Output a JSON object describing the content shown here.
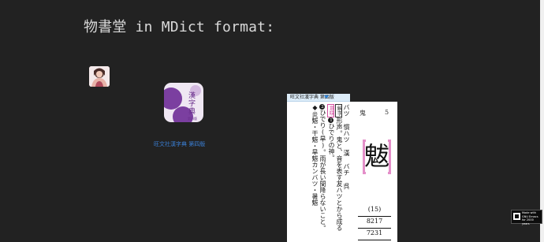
{
  "page": {
    "title": "物書堂 in MDict format:"
  },
  "app": {
    "icon_text": "漢字典",
    "icon_subtext": "第四版",
    "link_label": "旺文社漢字典 第四版",
    "icon_color": "#7b3fa0"
  },
  "dictionary": {
    "header_title": "旺文社漢字典 第四版",
    "radical": "鬼",
    "stroke_count": "5",
    "reading_col": "バツ 慣ハツ 漢 バチ 呉",
    "kaiji_label": "解字",
    "kaiji_col": "形声。鬼と、音を表す犮ハツとから成る",
    "imi_label": "意味",
    "meaning_1_num": "1",
    "meaning_1": "ひでりの神。",
    "meaning_2_num": "2",
    "meaning_2": "ひでり(旱)。雨が長い間降らないこと。",
    "compound_mark": "◆",
    "compounds": "炎魃・干魃・旱魃カンバツ・暑魃",
    "kanji": "魃",
    "total_strokes": "(15)",
    "code_1": "8217",
    "code_2": "7231"
  },
  "badge": {
    "text": "Made with\nGNU Emacs\nfor 2000 years"
  },
  "colors": {
    "background": "#222222",
    "title_text": "#d9d9d9",
    "link": "#3a7fd5",
    "accent_pink": "#d44ea0",
    "header_blue": "#dcecf8"
  }
}
